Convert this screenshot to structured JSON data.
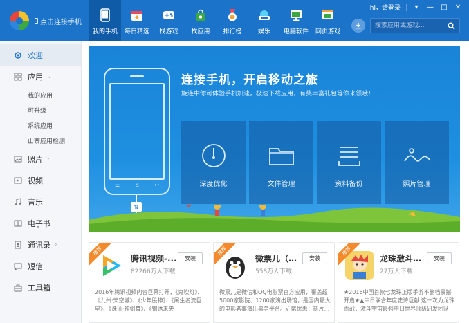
{
  "header": {
    "connect_label": "点击连接手机",
    "login": "hi，请登录",
    "search_placeholder": "搜索应用或游戏..."
  },
  "nav": [
    {
      "label": "我的手机",
      "icon": "phone-icon"
    },
    {
      "label": "每日精选",
      "icon": "calendar-star-icon"
    },
    {
      "label": "找游戏",
      "icon": "gamepad-icon"
    },
    {
      "label": "找应用",
      "icon": "shopping-bag-icon"
    },
    {
      "label": "排行榜",
      "icon": "medal-icon"
    },
    {
      "label": "娱乐",
      "icon": "cloud-icon"
    },
    {
      "label": "电脑软件",
      "icon": "monitor-icon"
    },
    {
      "label": "网页游戏",
      "icon": "web-game-icon"
    }
  ],
  "sidebar": {
    "items": [
      {
        "label": "欢迎",
        "icon": "gear-icon"
      },
      {
        "label": "应用",
        "icon": "grid-icon"
      },
      {
        "label": "照片",
        "icon": "photo-icon"
      },
      {
        "label": "视频",
        "icon": "video-icon"
      },
      {
        "label": "音乐",
        "icon": "music-icon"
      },
      {
        "label": "电子书",
        "icon": "book-icon"
      },
      {
        "label": "通讯录",
        "icon": "contacts-icon"
      },
      {
        "label": "短信",
        "icon": "sms-icon"
      },
      {
        "label": "工具箱",
        "icon": "toolbox-icon"
      }
    ],
    "app_subitems": [
      "我的应用",
      "可升级",
      "系统应用",
      "山寨应用检测"
    ]
  },
  "banner": {
    "title": "连接手机，开启移动之旅",
    "subtitle": "旋连中你可体验手机加速，极速下载应用，有奖丰富礼包等你来领哦！",
    "tiles": [
      {
        "label": "深度优化",
        "icon": "gauge-icon"
      },
      {
        "label": "文件管理",
        "icon": "folder-icon"
      },
      {
        "label": "资料备份",
        "icon": "backup-icon"
      },
      {
        "label": "照片管理",
        "icon": "landscape-icon"
      }
    ]
  },
  "cards": [
    {
      "name": "腾讯视频-...",
      "downloads": "82266万人下载",
      "button": "安装",
      "ribbon": "推荐",
      "desc": "2016年腾讯视频内容巨幕打开，《鬼吹灯》、《九州·天空城》、《少年股神》、《屠生名流巨星》、《诛仙·神剑舞》、《锦绣未央"
    },
    {
      "name": "微票儿（原...",
      "downloads": "558万人下载",
      "button": "安装",
      "ribbon": "推荐",
      "desc": "微票儿是微信和QQ电影票官方应用，覆盖超5000家影院、1200家演出场馆，是国内最大的电影者事演出票务平台。√ 帮优惠：新片..."
    },
    {
      "name": "龙珠激斗（...",
      "downloads": "27万人下载",
      "button": "安装",
      "ribbon": "推荐",
      "desc": "★2016中国首款七龙珠正版手游不删档震撼开启★▲中日联合年度史诗巨献 这一次为龙珠而战，激斗宇宙最强中日世界顶级研发团队"
    }
  ]
}
